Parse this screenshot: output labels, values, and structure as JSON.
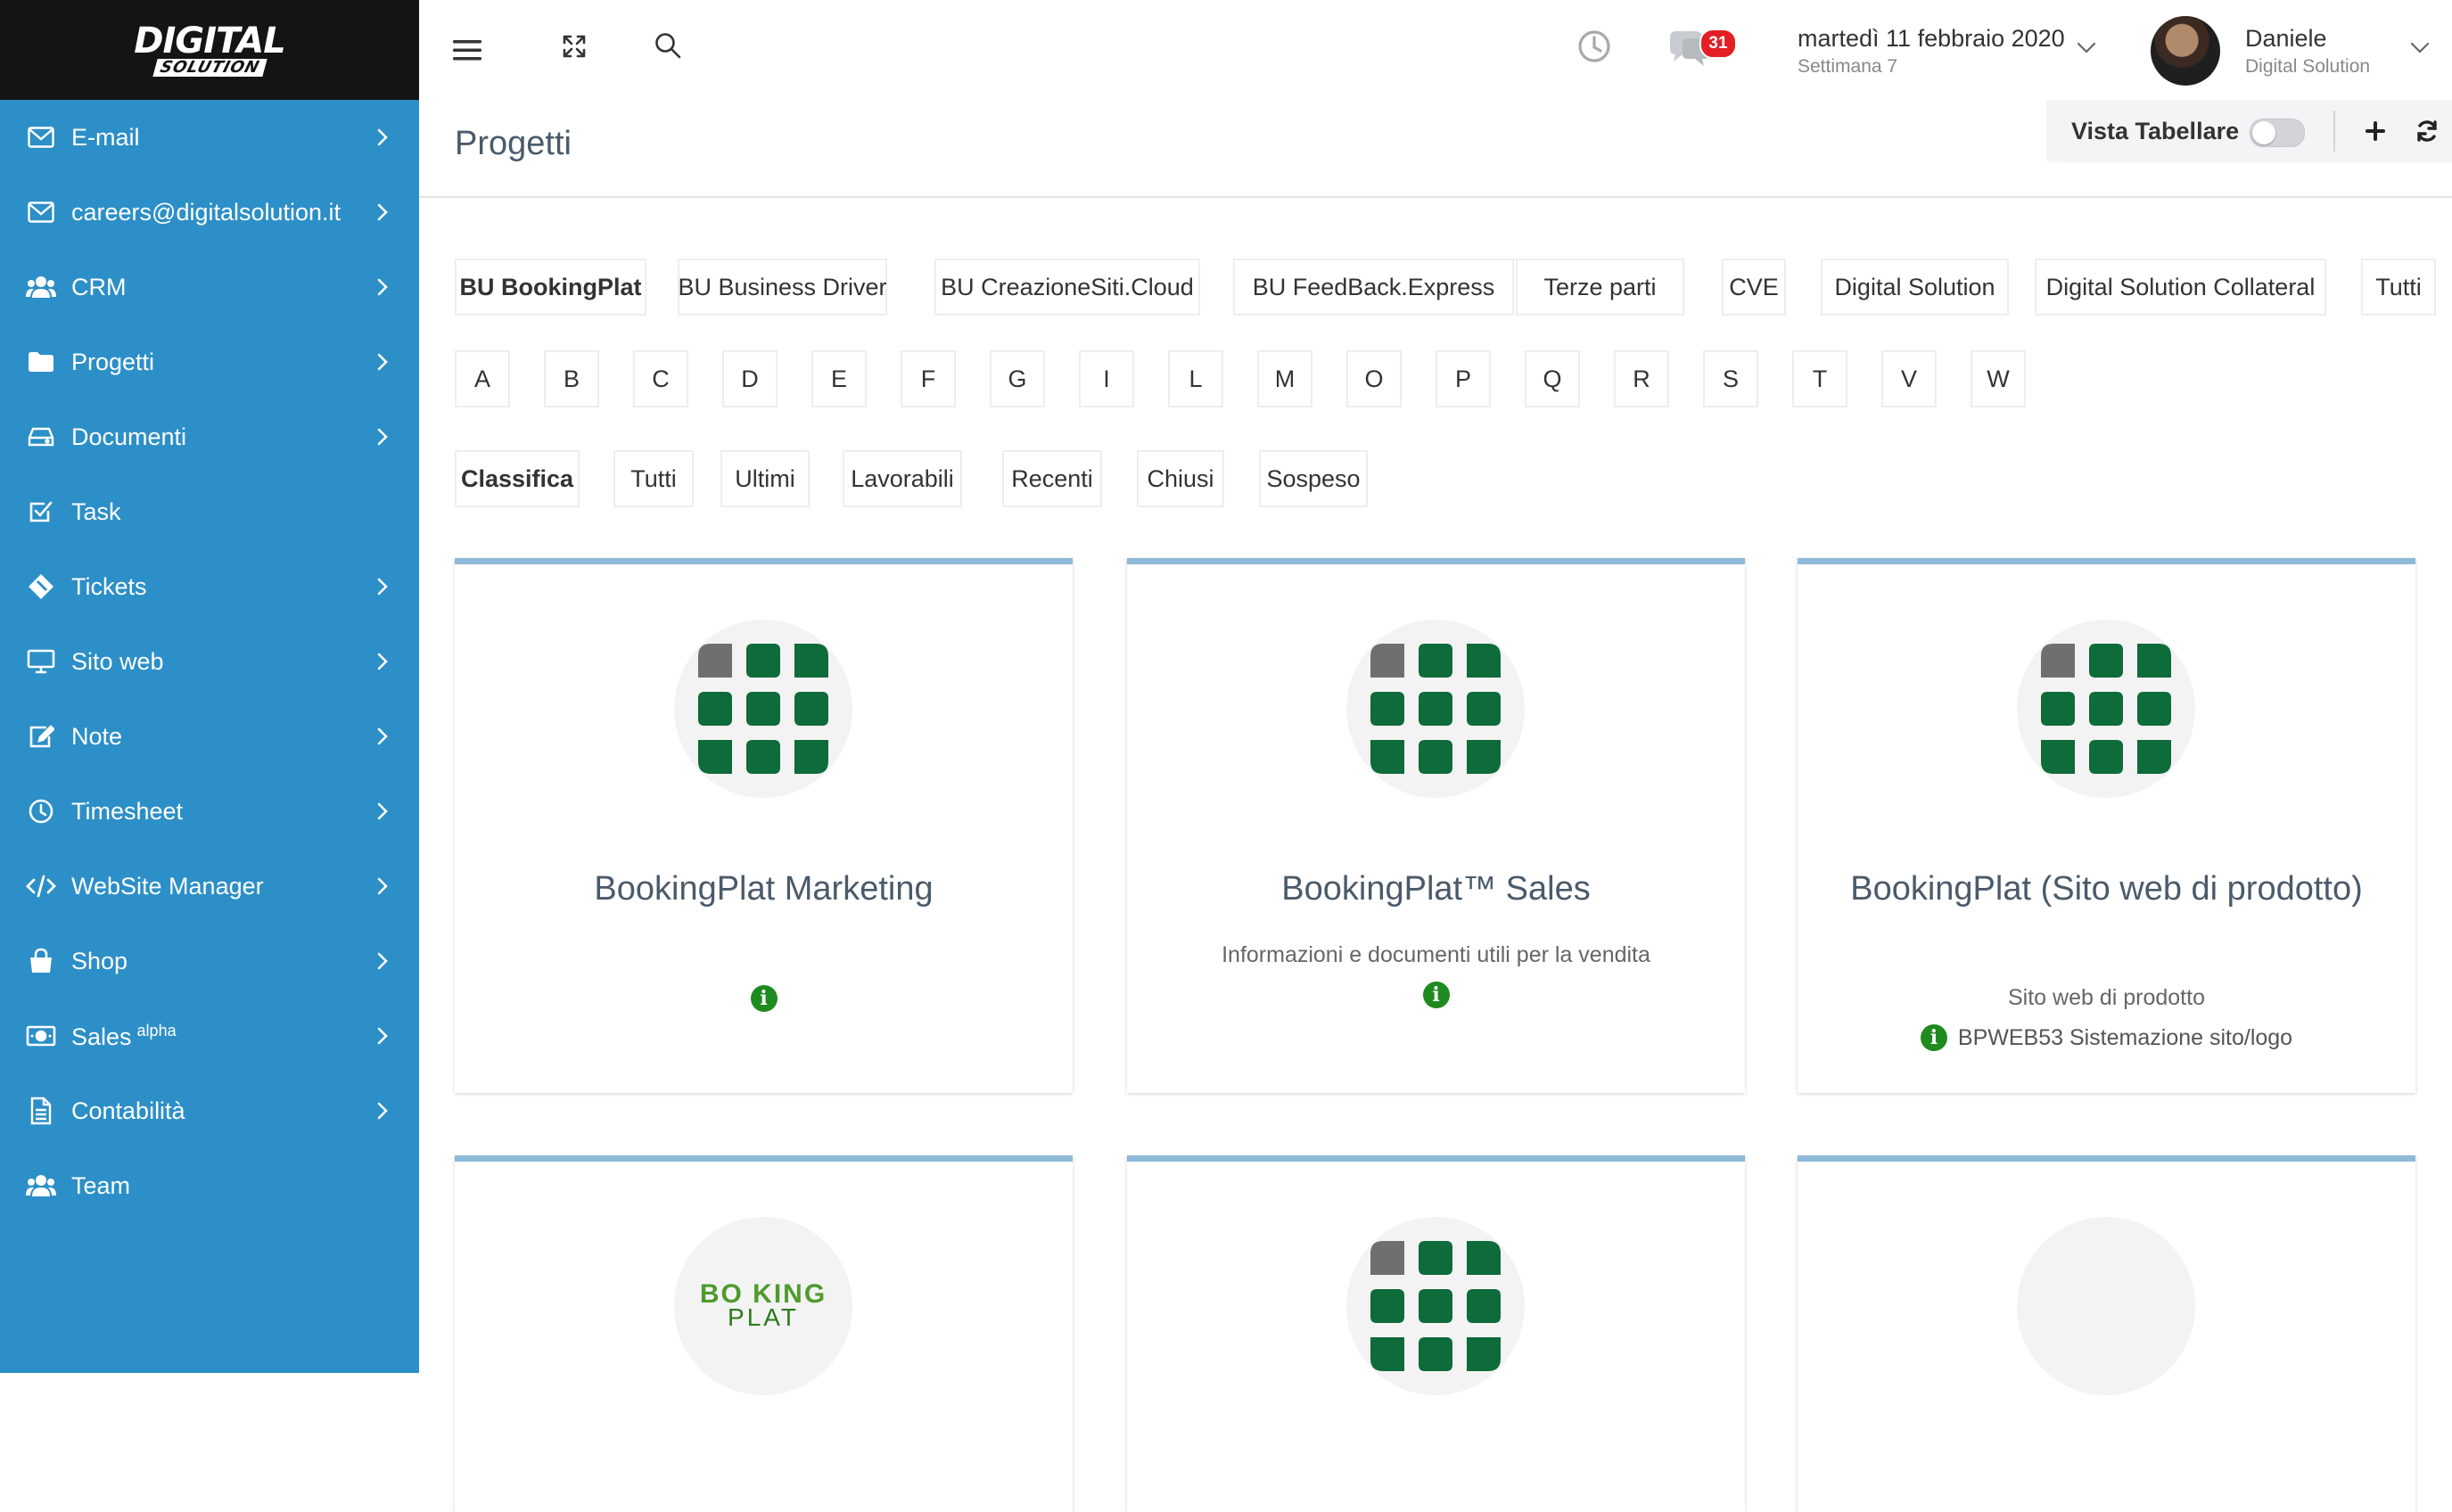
{
  "logo": {
    "line1": "DIGITAL",
    "line2": "SOLUTION"
  },
  "sidebar": {
    "items": [
      {
        "label": "E-mail",
        "icon": "mail-icon",
        "chevron": true
      },
      {
        "label": "careers@digitalsolution.it",
        "icon": "mail-icon",
        "chevron": true
      },
      {
        "label": "CRM",
        "icon": "users-icon",
        "chevron": true
      },
      {
        "label": "Progetti",
        "icon": "folder-icon",
        "chevron": true
      },
      {
        "label": "Documenti",
        "icon": "drive-icon",
        "chevron": true
      },
      {
        "label": "Task",
        "icon": "checkbox-icon",
        "chevron": false
      },
      {
        "label": "Tickets",
        "icon": "ticket-icon",
        "chevron": true
      },
      {
        "label": "Sito web",
        "icon": "monitor-icon",
        "chevron": true
      },
      {
        "label": "Note",
        "icon": "edit-icon",
        "chevron": true
      },
      {
        "label": "Timesheet",
        "icon": "clock-icon",
        "chevron": true
      },
      {
        "label": "WebSite Manager",
        "icon": "code-icon",
        "chevron": true
      },
      {
        "label": "Shop",
        "icon": "shopping-bag-icon",
        "chevron": true
      },
      {
        "label": "Sales",
        "sup": "alpha",
        "icon": "money-icon",
        "chevron": true
      },
      {
        "label": "Contabilità",
        "icon": "document-icon",
        "chevron": true
      },
      {
        "label": "Team",
        "icon": "users-icon",
        "chevron": false
      }
    ]
  },
  "topbar": {
    "notification_count": "31",
    "date": "martedì 11 febbraio 2020",
    "week": "Settimana 7",
    "user_name": "Daniele",
    "user_company": "Digital Solution"
  },
  "page": {
    "title": "Progetti",
    "vista_label": "Vista Tabellare",
    "vista_enabled": false
  },
  "filters": {
    "bu": [
      "BU BookingPlat",
      "BU Business Driver",
      "BU CreazioneSiti.Cloud",
      "BU FeedBack.Express",
      "Terze parti",
      "CVE",
      "Digital Solution",
      "Digital Solution Collateral",
      "Tutti"
    ],
    "letters": [
      "A",
      "B",
      "C",
      "D",
      "E",
      "F",
      "G",
      "I",
      "L",
      "M",
      "O",
      "P",
      "Q",
      "R",
      "S",
      "T",
      "V",
      "W"
    ],
    "status": [
      "Classifica",
      "Tutti",
      "Ultimi",
      "Lavorabili",
      "Recenti",
      "Chiusi",
      "Sospeso"
    ]
  },
  "cards": [
    {
      "title": "BookingPlat Marketing",
      "description": "",
      "info": "",
      "icon": "bookingplat-grid-icon"
    },
    {
      "title": "BookingPlat™ Sales",
      "description": "Informazioni e documenti utili per la vendita",
      "info": "",
      "icon": "bookingplat-grid-icon"
    },
    {
      "title": "BookingPlat (Sito web di prodotto)",
      "description": "Sito web di prodotto",
      "info": "BPWEB53 Sistemazione sito/logo",
      "icon": "bookingplat-grid-icon"
    },
    {
      "title": "",
      "description": "",
      "info": "",
      "icon": "bookingplat-wordmark-logo",
      "logo_line1": "BO  KING",
      "logo_line2": "PLAT"
    },
    {
      "title": "",
      "description": "",
      "info": "",
      "icon": "bookingplat-grid-icon"
    },
    {
      "title": "",
      "description": "",
      "info": "",
      "icon": "empty-icon"
    }
  ],
  "colors": {
    "sidebar": "#2c8fc7",
    "logo_bg": "#141414",
    "card_accent": "#8fb9d8",
    "grid_green": "#0e6b3a",
    "grid_gray": "#6f6f6f",
    "info_green": "#1f8a1f",
    "badge_red": "#e31e24"
  }
}
